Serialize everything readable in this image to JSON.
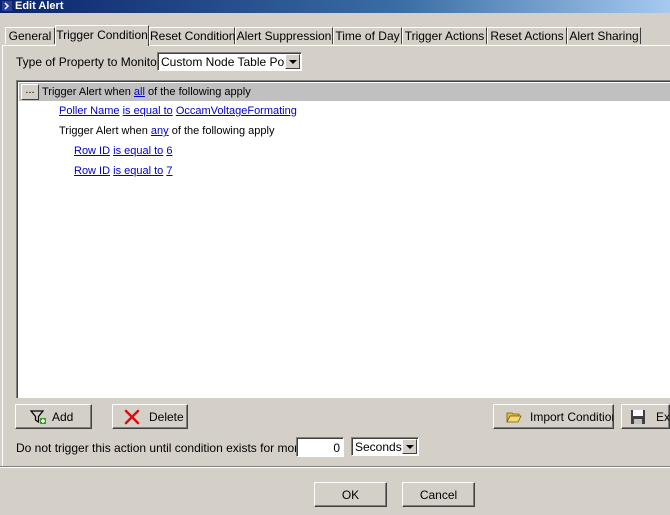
{
  "window": {
    "title": "Edit Alert"
  },
  "tabs": [
    {
      "label": "General",
      "active": false
    },
    {
      "label": "Trigger Condition",
      "active": true
    },
    {
      "label": "Reset Condition",
      "active": false
    },
    {
      "label": "Alert Suppression",
      "active": false
    },
    {
      "label": "Time of Day",
      "active": false
    },
    {
      "label": "Trigger Actions",
      "active": false
    },
    {
      "label": "Reset Actions",
      "active": false
    },
    {
      "label": "Alert Sharing",
      "active": false
    }
  ],
  "property": {
    "label": "Type of Property to Monitor:",
    "value": "Custom Node Table Poller"
  },
  "conditions": {
    "header_button": "...",
    "root": {
      "prefix": "Trigger Alert when ",
      "link": "all",
      "suffix": " of the following apply"
    },
    "c1": {
      "field": "Poller Name",
      "op": "is equal to",
      "value": "OccamVoltageFormating"
    },
    "group": {
      "prefix": "Trigger Alert when ",
      "link": "any",
      "suffix": " of the following apply"
    },
    "c2": {
      "field": "Row ID",
      "op": "is equal to",
      "value": "6"
    },
    "c3": {
      "field": "Row ID",
      "op": "is equal to",
      "value": "7"
    }
  },
  "toolbar": {
    "add_label": "Add",
    "delete_label": "Delete",
    "import_label": "Import Condition",
    "export_label": "Ex"
  },
  "duration": {
    "label": "Do not trigger this action until condition exists for more than",
    "value": "0",
    "unit": "Seconds"
  },
  "footer": {
    "ok_label": "OK",
    "cancel_label": "Cancel"
  },
  "colors": {
    "titlebar": "#0a246a",
    "link": "#0000cc",
    "face": "#d4d0c8"
  }
}
